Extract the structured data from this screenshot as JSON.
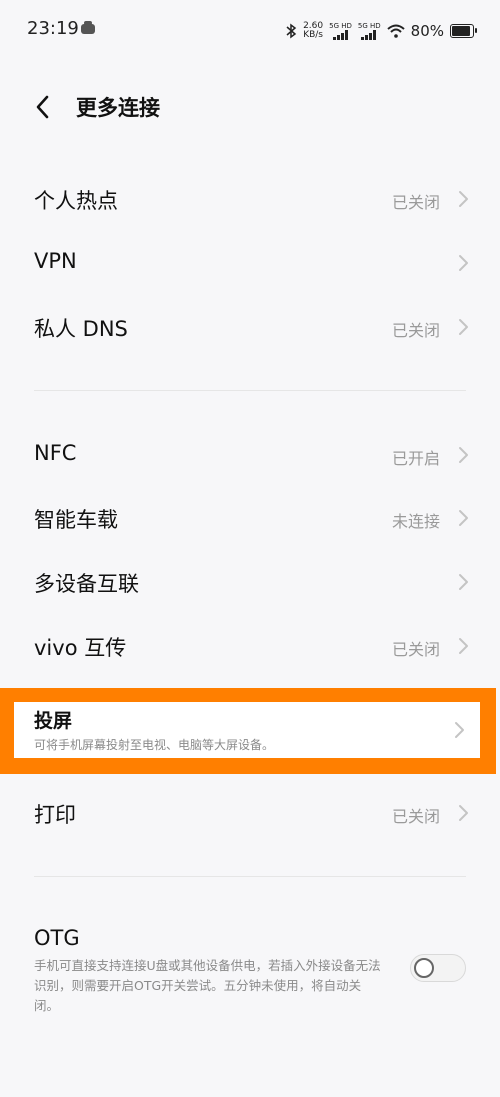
{
  "status_bar": {
    "time": "23:19",
    "net_speed_value": "2.60",
    "net_speed_unit": "KB/s",
    "sim1": "5G HD",
    "sim2": "5G HD",
    "battery_percent": "80%"
  },
  "header": {
    "title": "更多连接"
  },
  "group1": [
    {
      "label": "个人热点",
      "value": "已关闭"
    },
    {
      "label": "VPN",
      "value": ""
    },
    {
      "label": "私人 DNS",
      "value": "已关闭"
    }
  ],
  "group2": [
    {
      "label": "NFC",
      "value": "已开启"
    },
    {
      "label": "智能车载",
      "value": "未连接"
    },
    {
      "label": "多设备互联",
      "value": ""
    },
    {
      "label": "vivo 互传",
      "value": "已关闭"
    }
  ],
  "cast": {
    "label": "投屏",
    "description": "可将手机屏幕投射至电视、电脑等大屏设备。"
  },
  "print": {
    "label": "打印",
    "value": "已关闭"
  },
  "otg": {
    "label": "OTG",
    "description": "手机可直接支持连接U盘或其他设备供电，若插入外接设备无法识别，则需要开启OTG开关尝试。五分钟未使用，将自动关闭。",
    "enabled": false
  },
  "colors": {
    "highlight": "#ff7f00",
    "value_text": "#9a9a9a"
  }
}
